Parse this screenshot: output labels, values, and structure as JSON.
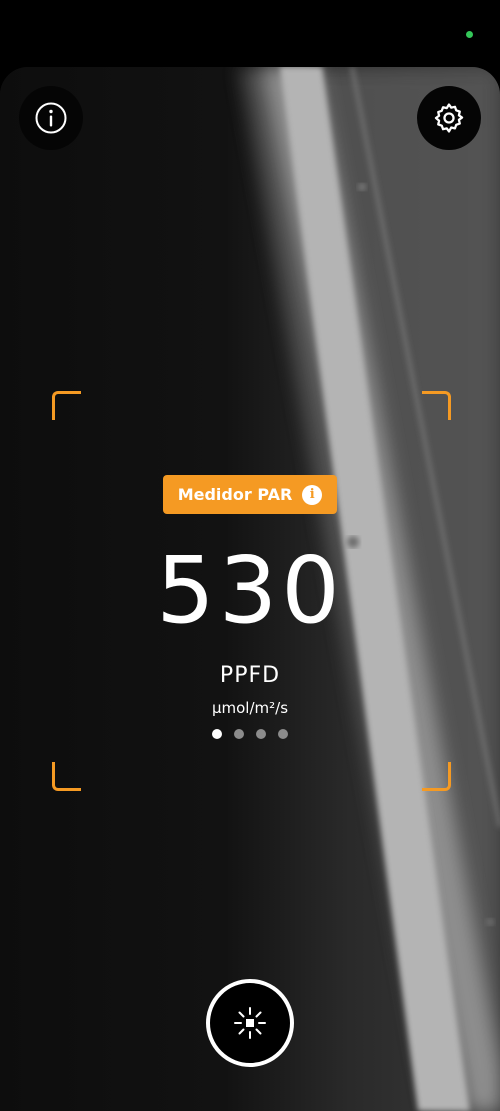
{
  "status_bar": {
    "indicator_color": "#34C759"
  },
  "toolbar": {
    "info_icon": "info-icon",
    "settings_icon": "gear-icon"
  },
  "meter": {
    "mode_label": "Medidor PAR",
    "mode_info_glyph": "i",
    "value": "530",
    "unit": "PPFD",
    "unit_detail": "μmol/m²/s",
    "pages": {
      "count": 4,
      "active_index": 0
    }
  },
  "capture": {
    "icon": "light-sun-icon"
  },
  "colors": {
    "accent": "#F59A23",
    "text": "#FFFFFF",
    "background": "#000000"
  }
}
